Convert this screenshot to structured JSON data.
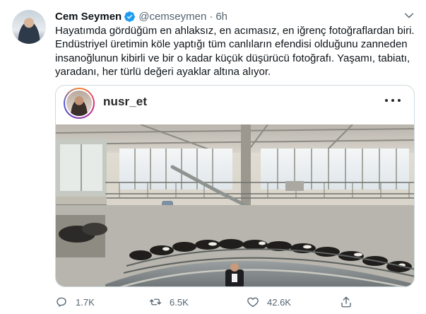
{
  "tweet": {
    "display_name": "Cem Seymen",
    "verified_icon": "verified-badge-icon",
    "handle": "@cemseymen",
    "separator": "·",
    "time": "6h",
    "text_lines": [
      "Hayatımda gördüğüm en ahlaksız, en acımasız, en iğrenç fotoğraflardan biri.",
      "Endüstriyel üretimin köle yaptığı tüm canlıların efendisi olduğunu zanneden",
      "insanoğlunun kibirli ve bir o kadar küçük düşürücü fotoğrafı. Yaşamı, tabiatı,",
      "yaradanı, her türlü değeri ayaklar altına alıyor."
    ]
  },
  "embed": {
    "username": "nusr_et",
    "more_icon": "more-dots-icon"
  },
  "actions": {
    "reply_count": "1.7K",
    "retweet_count": "6.5K",
    "like_count": "42.6K"
  },
  "colors": {
    "text": "#0f1419",
    "secondary": "#536471",
    "verified": "#1d9bf0",
    "border": "#cfd9de"
  }
}
